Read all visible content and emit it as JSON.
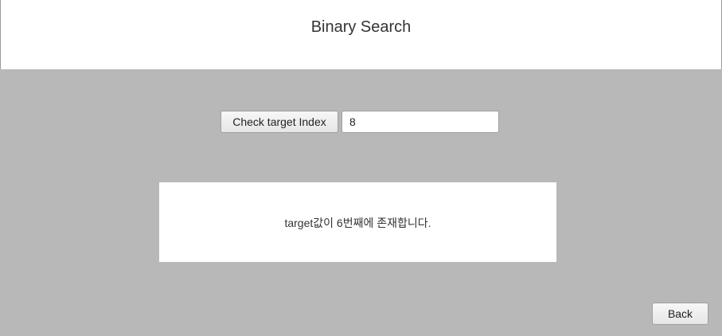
{
  "header": {
    "title": "Binary Search"
  },
  "controls": {
    "check_button_label": "Check target Index",
    "target_input_value": "8"
  },
  "result": {
    "message": "target값이 6번째에 존재합니다."
  },
  "footer": {
    "back_button_label": "Back"
  },
  "colors": {
    "background": "#b8b8b8",
    "panel": "#ffffff"
  }
}
